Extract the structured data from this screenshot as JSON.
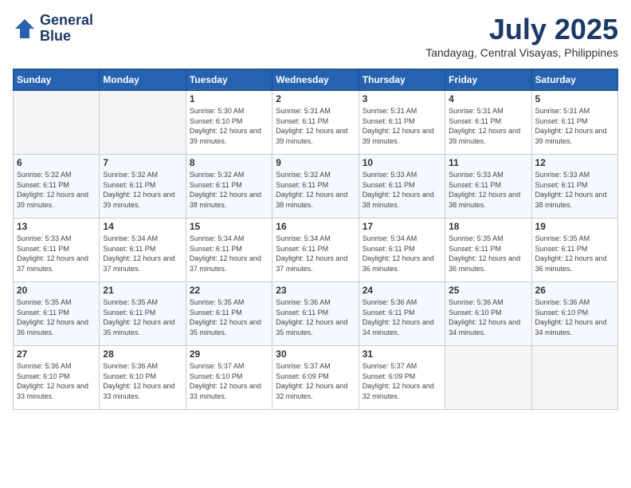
{
  "header": {
    "logo_line1": "General",
    "logo_line2": "Blue",
    "month": "July 2025",
    "location": "Tandayag, Central Visayas, Philippines"
  },
  "days_of_week": [
    "Sunday",
    "Monday",
    "Tuesday",
    "Wednesday",
    "Thursday",
    "Friday",
    "Saturday"
  ],
  "weeks": [
    [
      {
        "day": "",
        "info": ""
      },
      {
        "day": "",
        "info": ""
      },
      {
        "day": "1",
        "info": "Sunrise: 5:30 AM\nSunset: 6:10 PM\nDaylight: 12 hours and 39 minutes."
      },
      {
        "day": "2",
        "info": "Sunrise: 5:31 AM\nSunset: 6:11 PM\nDaylight: 12 hours and 39 minutes."
      },
      {
        "day": "3",
        "info": "Sunrise: 5:31 AM\nSunset: 6:11 PM\nDaylight: 12 hours and 39 minutes."
      },
      {
        "day": "4",
        "info": "Sunrise: 5:31 AM\nSunset: 6:11 PM\nDaylight: 12 hours and 39 minutes."
      },
      {
        "day": "5",
        "info": "Sunrise: 5:31 AM\nSunset: 6:11 PM\nDaylight: 12 hours and 39 minutes."
      }
    ],
    [
      {
        "day": "6",
        "info": "Sunrise: 5:32 AM\nSunset: 6:11 PM\nDaylight: 12 hours and 39 minutes."
      },
      {
        "day": "7",
        "info": "Sunrise: 5:32 AM\nSunset: 6:11 PM\nDaylight: 12 hours and 39 minutes."
      },
      {
        "day": "8",
        "info": "Sunrise: 5:32 AM\nSunset: 6:11 PM\nDaylight: 12 hours and 38 minutes."
      },
      {
        "day": "9",
        "info": "Sunrise: 5:32 AM\nSunset: 6:11 PM\nDaylight: 12 hours and 38 minutes."
      },
      {
        "day": "10",
        "info": "Sunrise: 5:33 AM\nSunset: 6:11 PM\nDaylight: 12 hours and 38 minutes."
      },
      {
        "day": "11",
        "info": "Sunrise: 5:33 AM\nSunset: 6:11 PM\nDaylight: 12 hours and 38 minutes."
      },
      {
        "day": "12",
        "info": "Sunrise: 5:33 AM\nSunset: 6:11 PM\nDaylight: 12 hours and 38 minutes."
      }
    ],
    [
      {
        "day": "13",
        "info": "Sunrise: 5:33 AM\nSunset: 6:11 PM\nDaylight: 12 hours and 37 minutes."
      },
      {
        "day": "14",
        "info": "Sunrise: 5:34 AM\nSunset: 6:11 PM\nDaylight: 12 hours and 37 minutes."
      },
      {
        "day": "15",
        "info": "Sunrise: 5:34 AM\nSunset: 6:11 PM\nDaylight: 12 hours and 37 minutes."
      },
      {
        "day": "16",
        "info": "Sunrise: 5:34 AM\nSunset: 6:11 PM\nDaylight: 12 hours and 37 minutes."
      },
      {
        "day": "17",
        "info": "Sunrise: 5:34 AM\nSunset: 6:11 PM\nDaylight: 12 hours and 36 minutes."
      },
      {
        "day": "18",
        "info": "Sunrise: 5:35 AM\nSunset: 6:11 PM\nDaylight: 12 hours and 36 minutes."
      },
      {
        "day": "19",
        "info": "Sunrise: 5:35 AM\nSunset: 6:11 PM\nDaylight: 12 hours and 36 minutes."
      }
    ],
    [
      {
        "day": "20",
        "info": "Sunrise: 5:35 AM\nSunset: 6:11 PM\nDaylight: 12 hours and 36 minutes."
      },
      {
        "day": "21",
        "info": "Sunrise: 5:35 AM\nSunset: 6:11 PM\nDaylight: 12 hours and 35 minutes."
      },
      {
        "day": "22",
        "info": "Sunrise: 5:35 AM\nSunset: 6:11 PM\nDaylight: 12 hours and 35 minutes."
      },
      {
        "day": "23",
        "info": "Sunrise: 5:36 AM\nSunset: 6:11 PM\nDaylight: 12 hours and 35 minutes."
      },
      {
        "day": "24",
        "info": "Sunrise: 5:36 AM\nSunset: 6:11 PM\nDaylight: 12 hours and 34 minutes."
      },
      {
        "day": "25",
        "info": "Sunrise: 5:36 AM\nSunset: 6:10 PM\nDaylight: 12 hours and 34 minutes."
      },
      {
        "day": "26",
        "info": "Sunrise: 5:36 AM\nSunset: 6:10 PM\nDaylight: 12 hours and 34 minutes."
      }
    ],
    [
      {
        "day": "27",
        "info": "Sunrise: 5:36 AM\nSunset: 6:10 PM\nDaylight: 12 hours and 33 minutes."
      },
      {
        "day": "28",
        "info": "Sunrise: 5:36 AM\nSunset: 6:10 PM\nDaylight: 12 hours and 33 minutes."
      },
      {
        "day": "29",
        "info": "Sunrise: 5:37 AM\nSunset: 6:10 PM\nDaylight: 12 hours and 33 minutes."
      },
      {
        "day": "30",
        "info": "Sunrise: 5:37 AM\nSunset: 6:09 PM\nDaylight: 12 hours and 32 minutes."
      },
      {
        "day": "31",
        "info": "Sunrise: 5:37 AM\nSunset: 6:09 PM\nDaylight: 12 hours and 32 minutes."
      },
      {
        "day": "",
        "info": ""
      },
      {
        "day": "",
        "info": ""
      }
    ]
  ]
}
